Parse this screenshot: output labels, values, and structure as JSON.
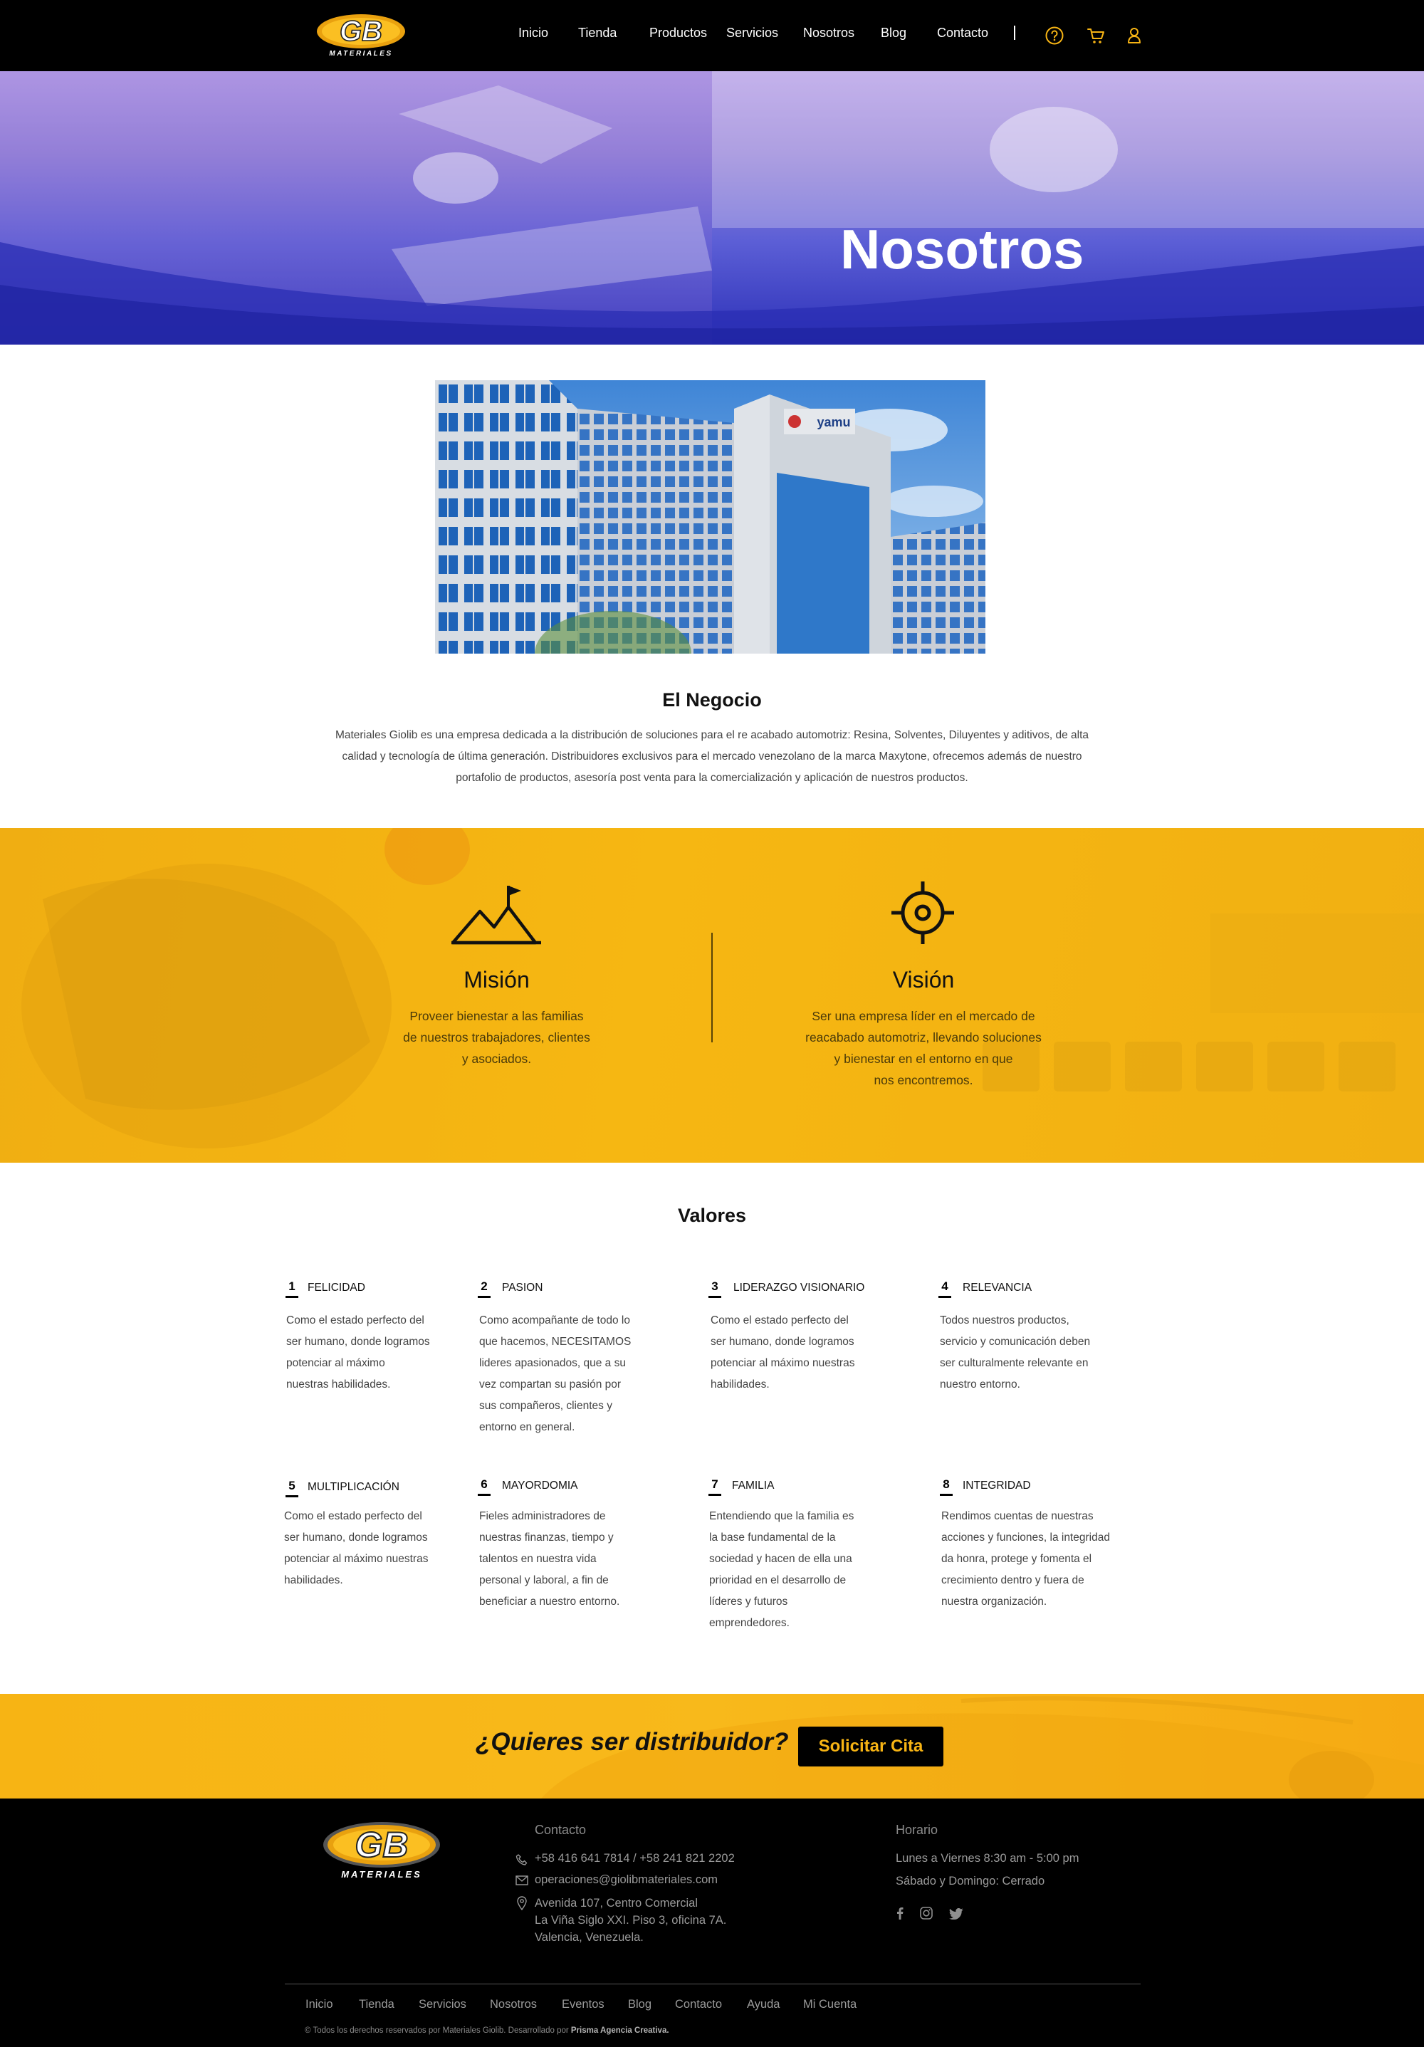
{
  "brand": {
    "logo_main": "GB",
    "logo_sub": "MATERIALES"
  },
  "nav": {
    "items": [
      "Inicio",
      "Tienda",
      "Productos",
      "Servicios",
      "Nosotros",
      "Blog",
      "Contacto"
    ],
    "separator": "|",
    "icons": [
      "help-icon",
      "cart-icon",
      "user-icon"
    ]
  },
  "hero": {
    "title": "Nosotros"
  },
  "negocio": {
    "image_sign": "yamu",
    "title": "El Negocio",
    "text": "Materiales Giolib es una empresa dedicada a la distribución de soluciones para el re acabado automotriz: Resina, Solventes, Diluyentes y aditivos, de alta calidad y tecnología de última generación. Distribuidores exclusivos para el mercado venezolano de la marca Maxytone, ofrecemos además de nuestro portafolio de productos, asesoría post venta para la comercialización y aplicación de nuestros productos."
  },
  "mision": {
    "title": "Misión",
    "lines": [
      "Proveer bienestar a las familias",
      "de nuestros trabajadores, clientes",
      "y asociados."
    ]
  },
  "vision": {
    "title": "Visión",
    "lines": [
      "Ser una empresa líder en el mercado de",
      "reacabado automotriz, llevando soluciones",
      "y bienestar en el entorno en que",
      "nos encontremos."
    ]
  },
  "valores": {
    "title": "Valores",
    "items": [
      {
        "num": "1",
        "name": "FELICIDAD",
        "lines": [
          "Como el estado perfecto del",
          "ser humano, donde logramos",
          "potenciar al máximo",
          "nuestras habilidades."
        ]
      },
      {
        "num": "2",
        "name": "PASION",
        "lines": [
          "Como acompañante de todo lo",
          "que hacemos, NECESITAMOS",
          "lideres apasionados, que a su",
          "vez compartan su pasión por",
          "sus compañeros, clientes y",
          "entorno en general."
        ]
      },
      {
        "num": "3",
        "name": "LIDERAZGO VISIONARIO",
        "lines": [
          "Como el estado perfecto del",
          "ser humano, donde logramos",
          "potenciar al máximo nuestras",
          "habilidades."
        ]
      },
      {
        "num": "4",
        "name": "RELEVANCIA",
        "lines": [
          "Todos nuestros productos,",
          "servicio y comunicación deben",
          "ser culturalmente relevante en",
          "nuestro entorno."
        ]
      },
      {
        "num": "5",
        "name": "MULTIPLICACIÓN",
        "lines": [
          "Como el estado perfecto del",
          "ser humano, donde logramos",
          "potenciar al máximo nuestras",
          "habilidades."
        ]
      },
      {
        "num": "6",
        "name": "MAYORDOMIA",
        "lines": [
          "Fieles administradores de",
          "nuestras finanzas, tiempo y",
          "talentos en nuestra vida",
          "personal y laboral, a fin de",
          "beneficiar a nuestro entorno."
        ]
      },
      {
        "num": "7",
        "name": "FAMILIA",
        "lines": [
          "Entendiendo que la familia es",
          "la base fundamental de la",
          "sociedad y hacen de ella una",
          "prioridad en el desarrollo de",
          "líderes y futuros",
          "emprendedores."
        ]
      },
      {
        "num": "8",
        "name": "INTEGRIDAD",
        "lines": [
          "Rendimos cuentas de nuestras",
          "acciones y funciones, la integridad",
          "da honra, protege y fomenta el",
          "crecimiento dentro y fuera de",
          "nuestra organización."
        ]
      }
    ]
  },
  "cta": {
    "text": "¿Quieres ser distribuidor?",
    "button": "Solicitar Cita"
  },
  "footer": {
    "contact_title": "Contacto",
    "phone": "+58 416 641 7814 / +58 241 821 2202",
    "email": "operaciones@giolibmateriales.com",
    "address": [
      "Avenida 107, Centro Comercial",
      "La Viña Siglo XXI. Piso 3, oficina 7A.",
      "Valencia, Venezuela."
    ],
    "hours_title": "Horario",
    "hours": [
      "Lunes a Viernes 8:30 am - 5:00 pm",
      "Sábado y Domingo: Cerrado"
    ],
    "social": [
      "facebook-icon",
      "instagram-icon",
      "twitter-icon"
    ],
    "nav": [
      "Inicio",
      "Tienda",
      "Servicios",
      "Nosotros",
      "Eventos",
      "Blog",
      "Contacto",
      "Ayuda",
      "Mi Cuenta"
    ],
    "copyright": "© Todos los derechos reservados por Materiales Giolib. Desarrollado por",
    "agency": "Prisma Agencia Creativa."
  },
  "colors": {
    "accent": "#F7B414",
    "hero_blue": "#2D31B8",
    "black": "#000000"
  }
}
